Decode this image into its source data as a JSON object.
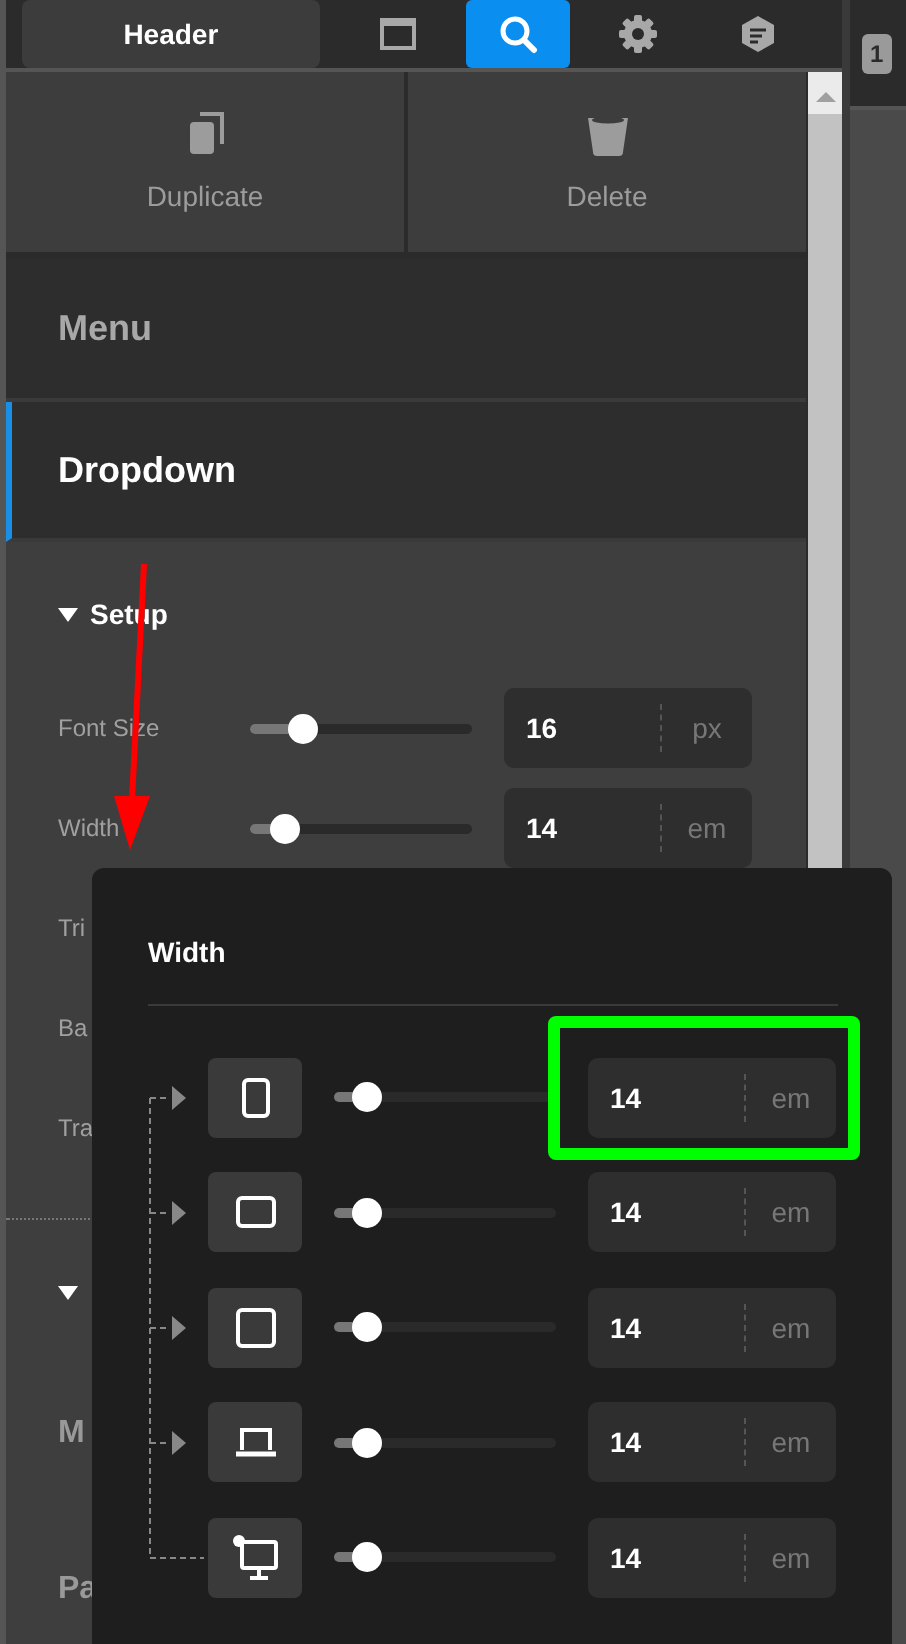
{
  "toolbar": {
    "title_button": "Header",
    "tools": [
      {
        "kind": "window",
        "selected": false
      },
      {
        "kind": "search",
        "selected": true
      },
      {
        "kind": "settings",
        "selected": false
      },
      {
        "kind": "note",
        "selected": false
      }
    ],
    "side_badge": "1"
  },
  "actions": [
    {
      "kind": "duplicate",
      "label": "Duplicate"
    },
    {
      "kind": "delete",
      "label": "Delete"
    }
  ],
  "nav": [
    {
      "label": "Menu",
      "selected": false
    },
    {
      "label": "Dropdown",
      "selected": true
    }
  ],
  "setup": {
    "title": "Setup",
    "expanded": true,
    "rows": [
      {
        "kind": "slider",
        "label": "Font Size",
        "level": 0.23,
        "value": "16",
        "unit": "px"
      },
      {
        "kind": "slider",
        "label": "Width",
        "level": 0.15,
        "value": "14",
        "unit": "em"
      },
      {
        "kind": "plain",
        "label": "Tri"
      },
      {
        "kind": "plain",
        "label": "Ba"
      },
      {
        "kind": "plain",
        "label": "Tra"
      }
    ]
  },
  "second_section": {
    "expanded": true,
    "rows": [
      "M",
      "Pa"
    ]
  },
  "popup": {
    "title": "Width",
    "devices": [
      {
        "kind": "phone",
        "level": 0.14,
        "value": "14",
        "unit": "em",
        "highlighted": true
      },
      {
        "kind": "tablet",
        "level": 0.14,
        "value": "14",
        "unit": "em",
        "highlighted": false
      },
      {
        "kind": "square",
        "level": 0.14,
        "value": "14",
        "unit": "em",
        "highlighted": false
      },
      {
        "kind": "laptop",
        "level": 0.14,
        "value": "14",
        "unit": "em",
        "highlighted": false
      },
      {
        "kind": "desktop",
        "level": 0.14,
        "value": "14",
        "unit": "em",
        "highlighted": false
      }
    ]
  }
}
